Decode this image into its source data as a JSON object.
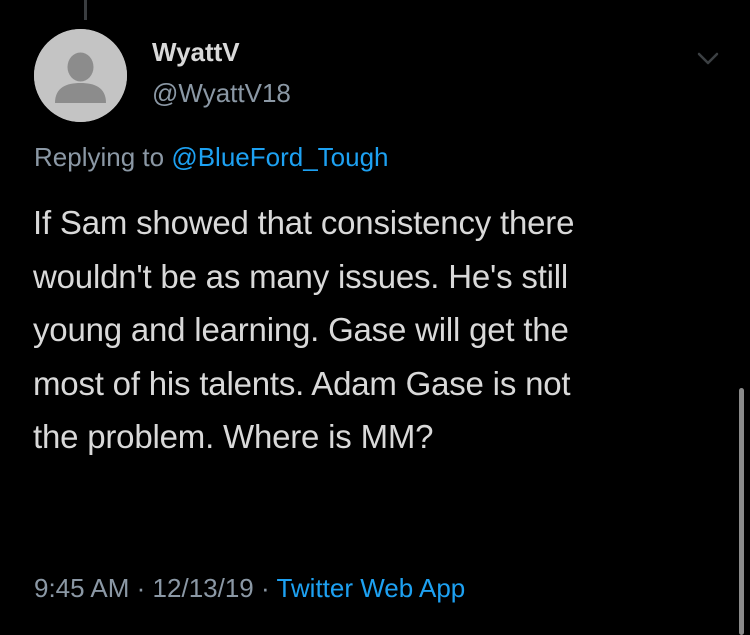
{
  "tweet": {
    "author": {
      "display_name": "WyattV",
      "handle": "@WyattV18",
      "avatar_icon": "default-profile-avatar-icon"
    },
    "menu_icon": "chevron-down-icon",
    "replying_to": {
      "prefix": "Replying to",
      "mention": "@BlueFord_Tough"
    },
    "text_lines": [
      "If Sam showed that consistency there",
      "wouldn't be as many issues. He's still",
      "young and learning. Gase will get the",
      "most of his talents. Adam Gase is not",
      "the problem. Where is MM?"
    ],
    "time": "9:45 AM",
    "separator": "·",
    "date": "12/13/19",
    "source": "Twitter Web App"
  },
  "colors": {
    "background": "#000000",
    "primary_text": "#d9d9d9",
    "secondary_text": "#8b98a5",
    "link": "#1da1f2",
    "avatar_bg": "#c4c4c4",
    "avatar_figure": "#8c8c8c"
  }
}
